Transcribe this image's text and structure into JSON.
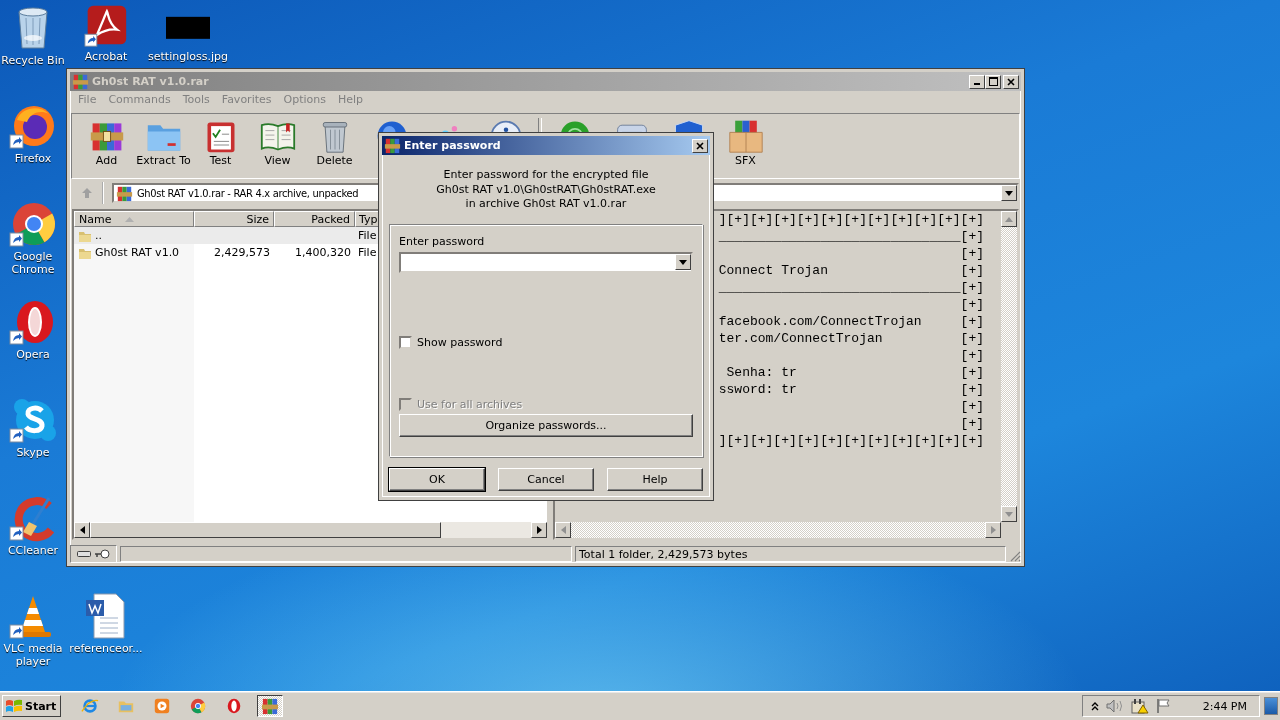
{
  "desktop_icons": [
    {
      "label": "Recycle Bin",
      "kind": "recycle"
    },
    {
      "label": "Acrobat",
      "kind": "acrobat"
    },
    {
      "label": "settingloss.jpg",
      "kind": "image"
    },
    {
      "label": "Firefox",
      "kind": "firefox"
    },
    {
      "label": "Google Chrome",
      "kind": "chrome"
    },
    {
      "label": "Opera",
      "kind": "opera"
    },
    {
      "label": "Skype",
      "kind": "skype"
    },
    {
      "label": "CCleaner",
      "kind": "ccleaner"
    },
    {
      "label": "VLC media player",
      "kind": "vlc"
    },
    {
      "label": "referenceor...",
      "kind": "word"
    }
  ],
  "archive_window": {
    "title": "Gh0st RAT v1.0.rar",
    "active": false,
    "menu": [
      "File",
      "Commands",
      "Tools",
      "Favorites",
      "Options",
      "Help"
    ],
    "toolbar": [
      {
        "label": "Add",
        "kind": "add"
      },
      {
        "label": "Extract To",
        "kind": "extract"
      },
      {
        "label": "Test",
        "kind": "test"
      },
      {
        "label": "View",
        "kind": "view"
      },
      {
        "label": "Delete",
        "kind": "delete"
      },
      {
        "kind": "find"
      },
      {
        "kind": "wizard"
      },
      {
        "kind": "info"
      },
      {
        "kind": "scan"
      },
      {
        "kind": "comment"
      },
      {
        "kind": "protect"
      },
      {
        "label": "SFX",
        "kind": "sfx"
      }
    ],
    "address": "Gh0st RAT v1.0.rar - RAR 4.x archive, unpacked",
    "columns": [
      "Name",
      "Size",
      "Packed",
      "Typ"
    ],
    "rows": [
      {
        "name": "..",
        "type": "File",
        "selected": true
      },
      {
        "name": "Gh0st RAT v1.0",
        "size": "2,429,573",
        "packed": "1,400,320",
        "type": "File",
        "selected": false
      }
    ],
    "comment_lines": [
      "][+][+][+][+][+][+][+][+][+][+][+]",
      "_______________________________[+]",
      "                               [+]",
      "Connect Trojan                 [+]",
      "_______________________________[+]",
      "                               [+]",
      "facebook.com/ConnectTrojan     [+]",
      "ter.com/ConnectTrojan          [+]",
      "                               [+]",
      " Senha: tr                     [+]",
      "ssword: tr                     [+]",
      "                               [+]",
      "                               [+]",
      "][+][+][+][+][+][+][+][+][+][+][+]"
    ],
    "status": "Total 1 folder, 2,429,573 bytes"
  },
  "password_dialog": {
    "title": "Enter password",
    "active": true,
    "message": [
      "Enter password for the encrypted file",
      "Gh0st RAT v1.0\\Gh0stRAT\\Gh0stRAT.exe",
      "in archive Gh0st RAT v1.0.rar"
    ],
    "field_label": "Enter password",
    "options": [
      {
        "label": "Show password",
        "checked": false,
        "disabled": false
      },
      {
        "label": "Use for all archives",
        "checked": false,
        "disabled": true
      }
    ],
    "organize_button": "Organize passwords...",
    "buttons": [
      {
        "label": "OK",
        "default": true
      },
      {
        "label": "Cancel",
        "default": false
      },
      {
        "label": "Help",
        "default": false
      }
    ]
  },
  "taskbar": {
    "start": "Start",
    "apps": [
      {
        "kind": "ie",
        "active": false
      },
      {
        "kind": "explorer",
        "active": false
      },
      {
        "kind": "media",
        "active": false
      },
      {
        "kind": "chrome",
        "active": false
      },
      {
        "kind": "opera",
        "active": false
      },
      {
        "kind": "winrar",
        "active": true
      }
    ],
    "clock": "2:44 PM"
  }
}
